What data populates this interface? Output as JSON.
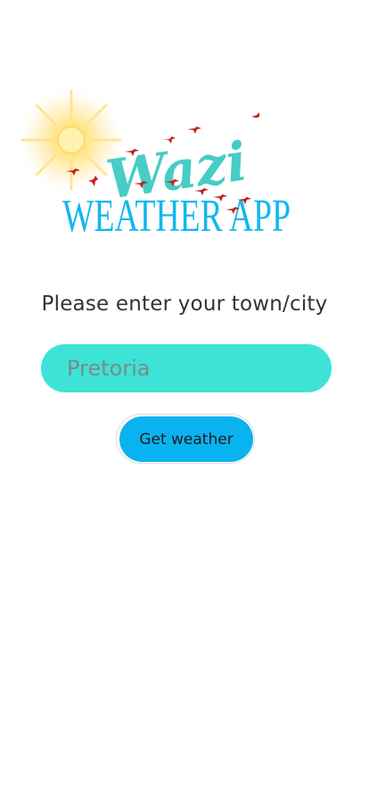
{
  "logo": {
    "script_text": "Wazi",
    "title_text": "WEATHER APP",
    "script_color": "#47ccc6",
    "title_color": "#12b8ee",
    "bird_color": "#c41e1e",
    "sun_color": "#ffe37a"
  },
  "form": {
    "prompt": "Please enter your town/city",
    "city_placeholder": "Pretoria",
    "city_value": "",
    "input_color": "#3de3d7",
    "submit_label": "Get weather",
    "button_color": "#0ab3f0"
  }
}
